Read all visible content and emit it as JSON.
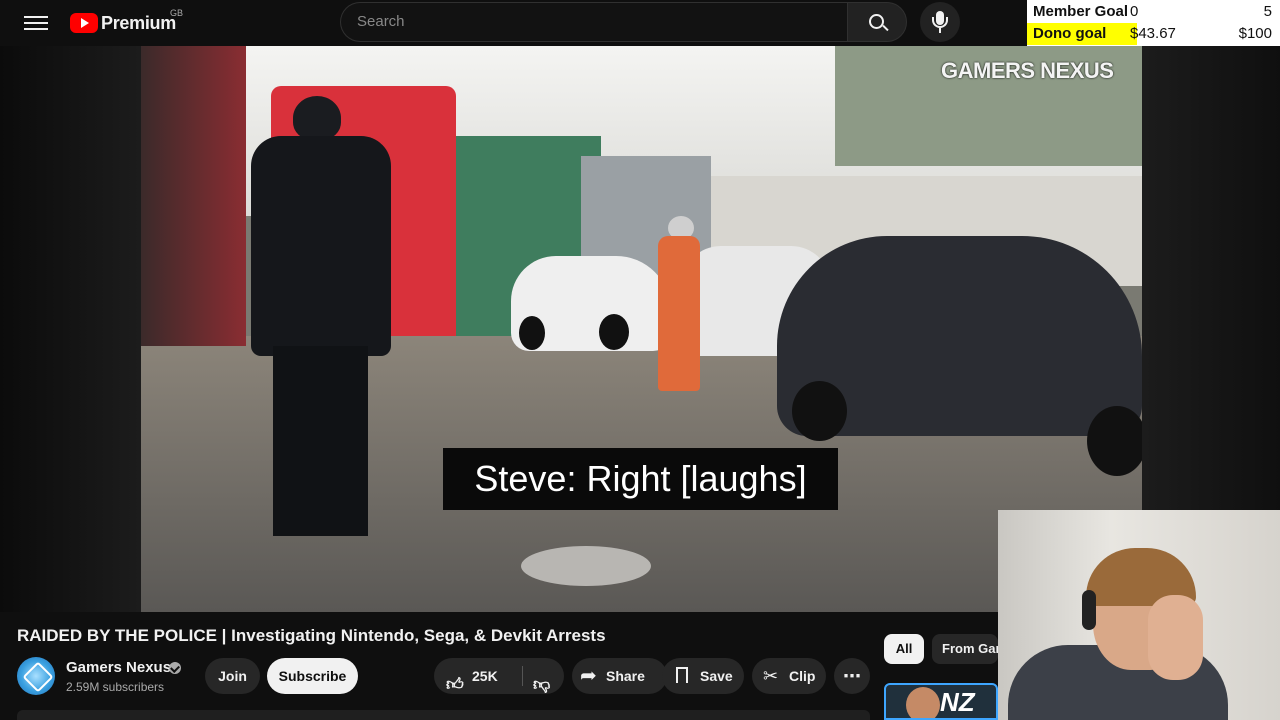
{
  "header": {
    "logo_text": "Premium",
    "region": "GB",
    "search_placeholder": "Search",
    "icons": {
      "menu": "hamburger-icon",
      "search": "search-icon",
      "mic": "mic-icon"
    }
  },
  "goals": {
    "member": {
      "label": "Member Goal",
      "current": "0",
      "target": "5"
    },
    "dono": {
      "label": "Dono goal",
      "current": "$43.67",
      "target": "$100",
      "progress_fraction": 0.4367
    },
    "colors": {
      "dono_fill": "#ffff00"
    }
  },
  "video": {
    "watermark": "GAMERS NEXUS",
    "caption": "Steve: Right [laughs]"
  },
  "below_video": {
    "title": "RAIDED BY THE POLICE | Investigating Nintendo, Sega, & Devkit Arrests",
    "channel": {
      "name": "Gamers Nexus",
      "subscribers": "2.59M subscribers"
    },
    "buttons": {
      "join": "Join",
      "subscribe": "Subscribe",
      "like_count": "25K",
      "share": "Share",
      "save": "Save",
      "clip": "Clip",
      "more": "⋯"
    }
  },
  "recommendations": {
    "chips": [
      "All",
      "From Gam"
    ],
    "thumb_text": "NZ"
  },
  "colors": {
    "background": "#0f0f0f",
    "accent_red": "#ff0000",
    "pill": "#272727",
    "selected_outline": "#3ea6ff"
  }
}
